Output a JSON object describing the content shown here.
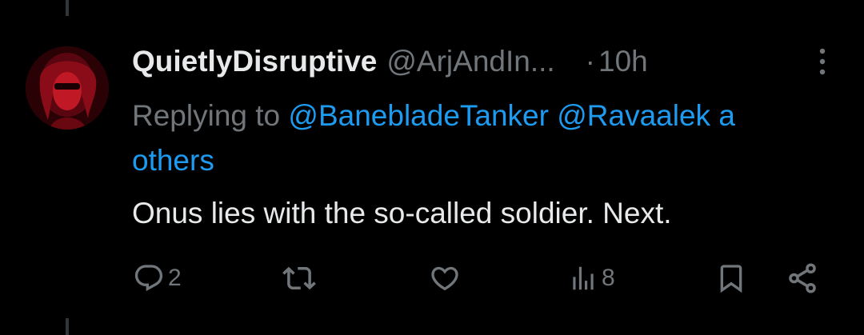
{
  "tweet": {
    "display_name": "QuietlyDisruptive",
    "handle": "@ArjAndIn...",
    "separator": "·",
    "time": "10h",
    "reply_prefix": "Replying to ",
    "mentions": [
      "@BanebladeTanker",
      "@Ravaalek"
    ],
    "mention_trailing": " a",
    "mention_overflow": "others",
    "text": "Onus lies with the so-called soldier. Next."
  },
  "actions": {
    "reply_count": "2",
    "views_count": "8"
  },
  "icons": {
    "more": "more-vertical-icon",
    "reply": "reply-icon",
    "repost": "repost-icon",
    "like": "heart-icon",
    "views": "views-chart-icon",
    "bookmark": "bookmark-icon",
    "share": "share-icon"
  },
  "colors": {
    "background": "#000000",
    "text_primary": "#e7e9ea",
    "text_secondary": "#71767b",
    "accent": "#1d9bf0",
    "thread_line": "#333639"
  }
}
